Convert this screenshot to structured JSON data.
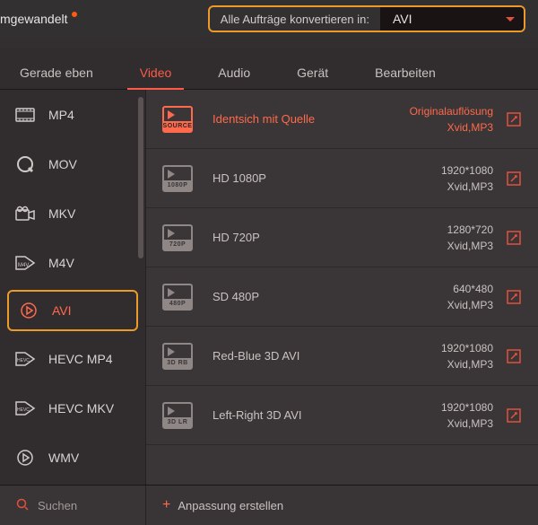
{
  "top": {
    "partial_text": "mgewandelt",
    "convert_label": "Alle Aufträge konvertieren in:",
    "convert_value": "AVI"
  },
  "tabs": {
    "t0": "Gerade eben",
    "t1": "Video",
    "t2": "Audio",
    "t3": "Gerät",
    "t4": "Bearbeiten"
  },
  "sidebar": {
    "f0": "MP4",
    "f1": "MOV",
    "f2": "MKV",
    "f3": "M4V",
    "f4": "AVI",
    "f5": "HEVC MP4",
    "f6": "HEVC MKV",
    "f7": "WMV"
  },
  "presets": {
    "p0": {
      "icon": "SOURCE",
      "title": "Identsich mit Quelle",
      "res": "Originalauflösung",
      "codec": "Xvid,MP3"
    },
    "p1": {
      "icon": "1080P",
      "title": "HD 1080P",
      "res": "1920*1080",
      "codec": "Xvid,MP3"
    },
    "p2": {
      "icon": "720P",
      "title": "HD 720P",
      "res": "1280*720",
      "codec": "Xvid,MP3"
    },
    "p3": {
      "icon": "480P",
      "title": "SD 480P",
      "res": "640*480",
      "codec": "Xvid,MP3"
    },
    "p4": {
      "icon": "3D RB",
      "title": "Red-Blue 3D AVI",
      "res": "1920*1080",
      "codec": "Xvid,MP3"
    },
    "p5": {
      "icon": "3D LR",
      "title": "Left-Right 3D AVI",
      "res": "1920*1080",
      "codec": "Xvid,MP3"
    }
  },
  "footer": {
    "search": "Suchen",
    "custom": "Anpassung erstellen"
  }
}
